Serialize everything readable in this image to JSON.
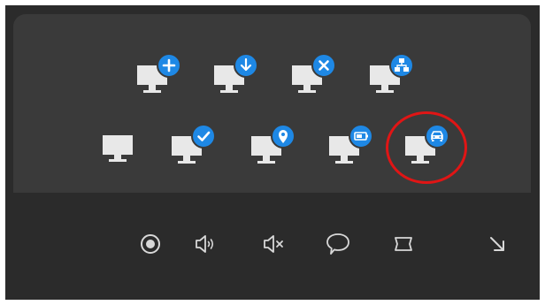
{
  "icon_grid": {
    "row1": [
      {
        "name": "monitor-add-icon",
        "badge": "plus"
      },
      {
        "name": "monitor-download-icon",
        "badge": "download"
      },
      {
        "name": "monitor-remove-icon",
        "badge": "close"
      },
      {
        "name": "monitor-network-icon",
        "badge": "network"
      }
    ],
    "row2": [
      {
        "name": "monitor-icon",
        "badge": "none"
      },
      {
        "name": "monitor-check-icon",
        "badge": "check"
      },
      {
        "name": "monitor-location-icon",
        "badge": "location"
      },
      {
        "name": "monitor-battery-icon",
        "badge": "battery"
      },
      {
        "name": "monitor-car-icon",
        "badge": "car",
        "highlighted": true
      }
    ]
  },
  "toolbar": {
    "items": [
      "record-icon",
      "volume-icon",
      "mute-icon",
      "speech-bubble-icon",
      "frame-icon",
      "arrow-down-right-icon"
    ]
  },
  "colors": {
    "background": "#2b2b2b",
    "panel": "#3a3a3a",
    "monitor": "#e8e8e8",
    "badge": "#1e88e5",
    "highlight": "#e01515",
    "toolbar_icon": "#d8d8d8"
  }
}
